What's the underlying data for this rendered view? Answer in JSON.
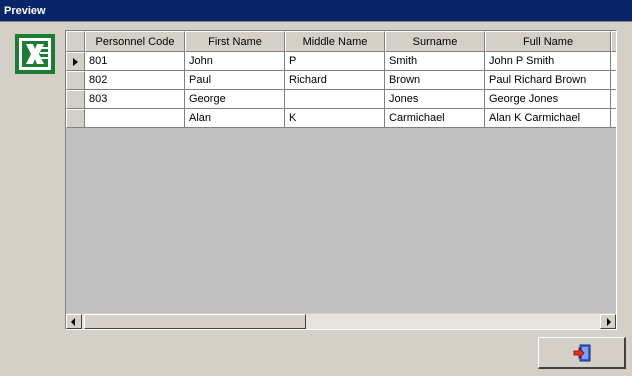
{
  "window": {
    "title": "Preview"
  },
  "grid": {
    "columns": [
      "Personnel Code",
      "First Name",
      "Middle Name",
      "Surname",
      "Full Name"
    ],
    "rows": [
      [
        "801",
        "John",
        "P",
        "Smith",
        "John P Smith"
      ],
      [
        "802",
        "Paul",
        "Richard",
        "Brown",
        "Paul Richard Brown"
      ],
      [
        "803",
        "George",
        "",
        "Jones",
        "George Jones"
      ],
      [
        "",
        "Alan",
        "K",
        "Carmichael",
        "Alan K Carmichael"
      ]
    ],
    "current_row_index": 0
  },
  "icons": {
    "export": "excel-icon",
    "exit": "exit-icon"
  },
  "colors": {
    "titlebar": "#0a246a",
    "window_bg": "#d4d0c8",
    "grid_empty": "#c0c0c0",
    "excel_green": "#1e7b34"
  }
}
